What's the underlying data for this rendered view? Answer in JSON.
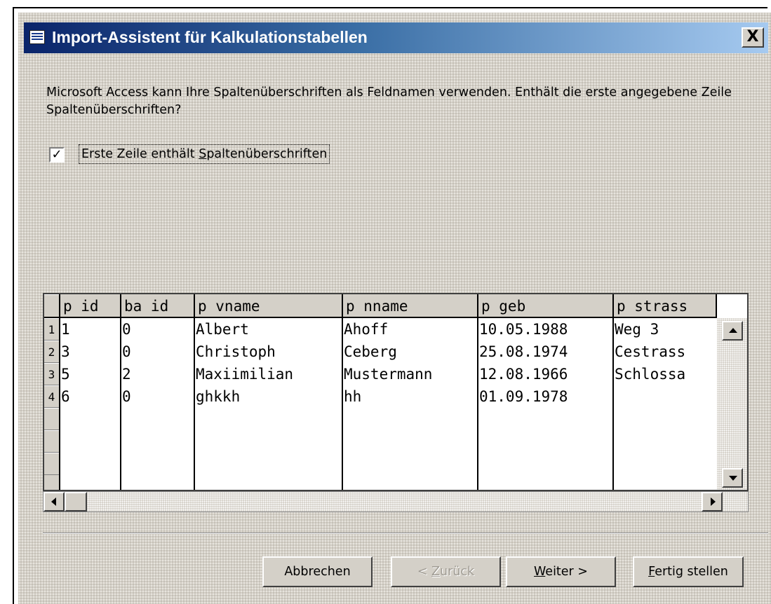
{
  "dialog": {
    "title": "Import-Assistent für Kalkulationstabellen",
    "close_label": "X",
    "prompt": "Microsoft Access kann Ihre Spaltenüberschriften als Feldnamen verwenden. Enthält die erste angegebene Zeile Spaltenüberschriften?"
  },
  "checkbox": {
    "checked": true,
    "mark": "✓",
    "label_pre": "Erste Zeile enthält ",
    "label_mnemonic": "S",
    "label_post": "paltenüberschriften"
  },
  "grid": {
    "columns": [
      "p id",
      "ba id",
      "p vname",
      "p nname",
      "p geb",
      "p strass"
    ],
    "row_numbers": [
      "1",
      "2",
      "3",
      "4"
    ],
    "rows": [
      [
        "1",
        "0",
        "Albert",
        "Ahoff",
        "10.05.1988",
        "Weg 3"
      ],
      [
        "3",
        "0",
        "Christoph",
        "Ceberg",
        "25.08.1974",
        "Cestrass"
      ],
      [
        "5",
        "2",
        "Maxiimilian",
        "Mustermann",
        "12.08.1966",
        "Schlossa"
      ],
      [
        "6",
        "0",
        "ghkkh",
        "hh",
        "01.09.1978",
        ""
      ]
    ]
  },
  "buttons": {
    "cancel": "Abbrechen",
    "back_pre": "< ",
    "back_mnemonic": "Z",
    "back_post": "urück",
    "next_mnemonic": "W",
    "next_post": "eiter >",
    "finish_mnemonic": "F",
    "finish_post": "ertig stellen"
  },
  "colors": {
    "titlebar_start": "#0a246a",
    "titlebar_end": "#a6caf0",
    "face": "#d4d0c8"
  }
}
